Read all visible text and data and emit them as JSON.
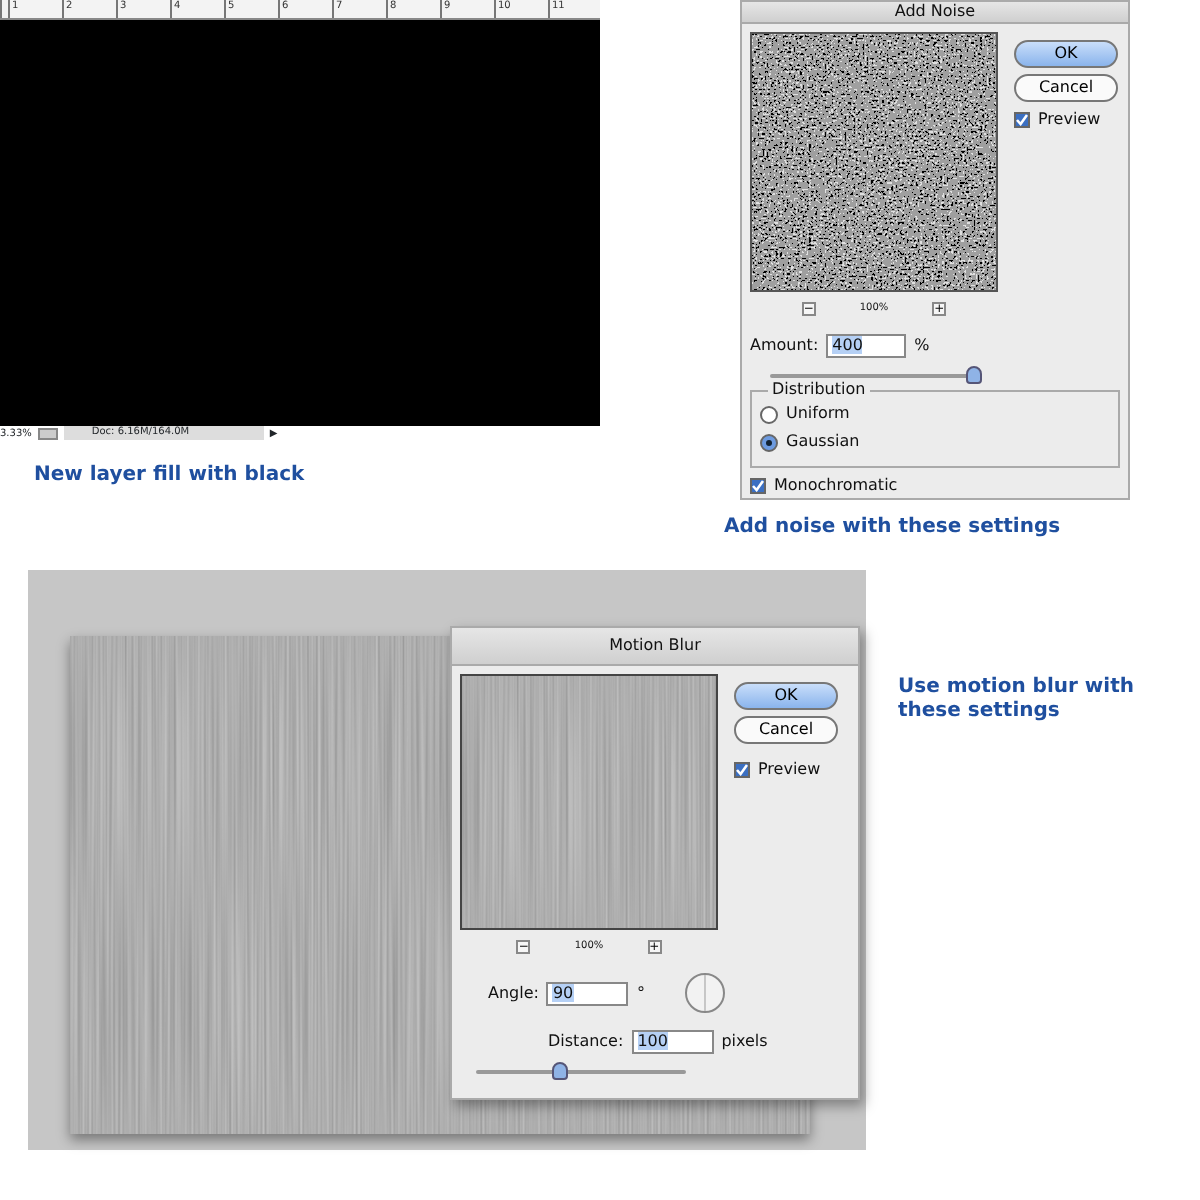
{
  "canvas_window": {
    "ruler_labels": [
      "1",
      "2",
      "3",
      "4",
      "5",
      "6",
      "7",
      "8",
      "9",
      "10",
      "11"
    ],
    "status_bar": {
      "zoom": "3.33%",
      "doc_info": "Doc: 6.16M/164.0M",
      "arrow": "▶"
    },
    "caption": "New layer fill with black"
  },
  "add_noise_dialog": {
    "title": "Add Noise",
    "zoom_minus": "−",
    "zoom": "100%",
    "zoom_plus": "+",
    "buttons": [
      {
        "label": "OK",
        "default": true
      },
      {
        "label": "Cancel",
        "default": false
      }
    ],
    "preview": {
      "label": "Preview",
      "checked": true
    },
    "amount": {
      "label": "Amount:",
      "value": "400",
      "unit": "%",
      "level": 1.0
    },
    "distribution": {
      "legend": "Distribution",
      "options": [
        {
          "label": "Uniform",
          "selected": false
        },
        {
          "label": "Gaussian",
          "selected": true
        }
      ]
    },
    "monochromatic": {
      "label": "Monochromatic",
      "checked": true
    },
    "caption": "Add noise with these settings"
  },
  "motion_blur_dialog": {
    "title": "Motion Blur",
    "zoom_minus": "−",
    "zoom": "100%",
    "zoom_plus": "+",
    "buttons": [
      {
        "label": "OK",
        "default": true
      },
      {
        "label": "Cancel",
        "default": false
      }
    ],
    "preview": {
      "label": "Preview",
      "checked": true
    },
    "angle": {
      "label": "Angle:",
      "value": "90",
      "unit": "°"
    },
    "distance": {
      "label": "Distance:",
      "value": "100",
      "unit": "pixels",
      "level": 0.4
    },
    "caption": "Use motion blur with these settings"
  }
}
